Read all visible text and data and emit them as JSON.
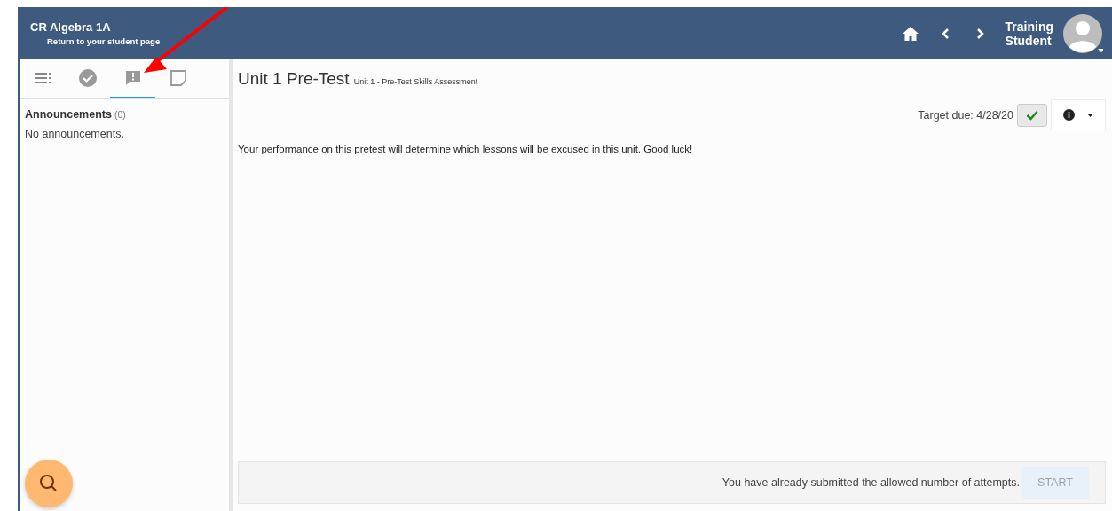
{
  "header": {
    "course": "CR Algebra 1A",
    "return_link": "Return to your student page",
    "user": [
      "Training",
      "Student"
    ]
  },
  "sidebar": {
    "tabs": [
      {
        "kind": "list",
        "selected": false
      },
      {
        "kind": "check",
        "selected": false
      },
      {
        "kind": "announce",
        "selected": true
      },
      {
        "kind": "note",
        "selected": false
      }
    ],
    "section_title": "Announcements",
    "count": "(0)",
    "empty_text": "No announcements."
  },
  "main": {
    "title": "Unit 1 Pre-Test",
    "subtitle": "Unit 1 - Pre-Test Skills Assessment",
    "target_due": "Target due: 4/28/20",
    "description": "Your performance on this pretest will determine which lessons will be excused in this unit. Good luck!",
    "footer": {
      "message": "You have already submitted the allowed number of attempts.",
      "button": "START",
      "button_disabled": true
    }
  }
}
